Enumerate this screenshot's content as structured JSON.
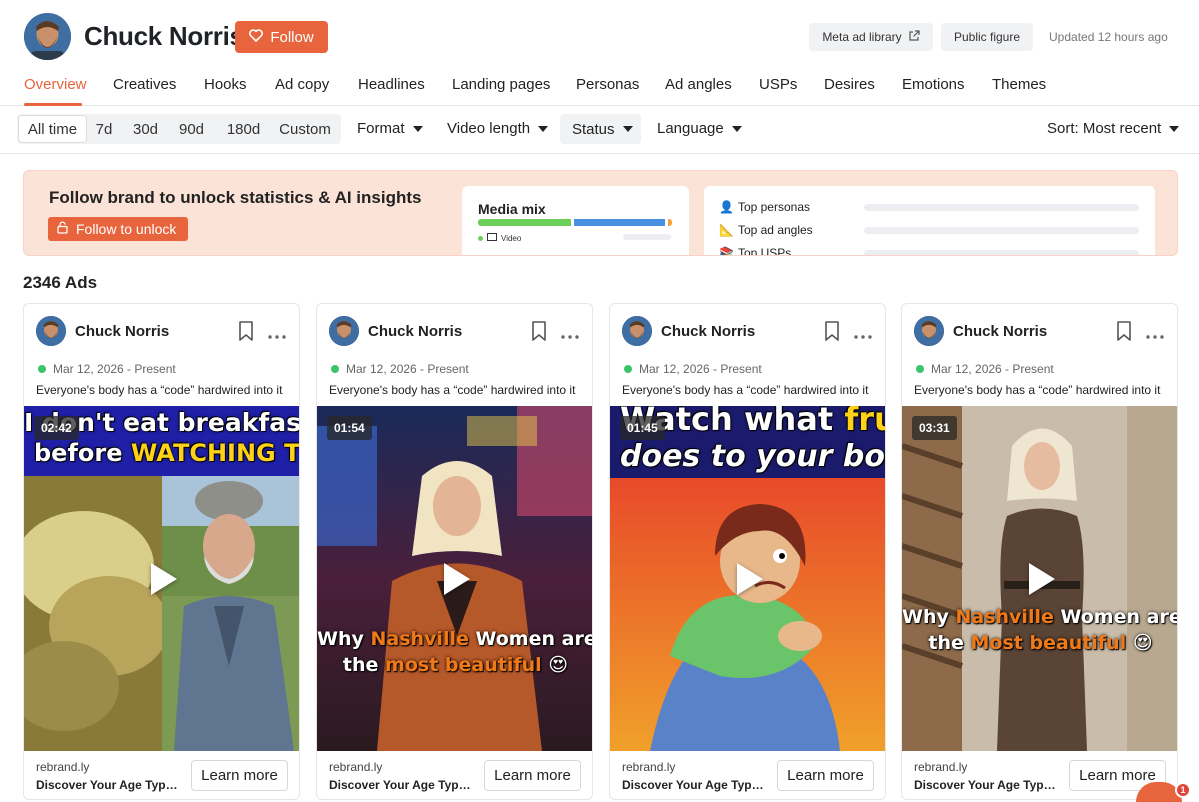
{
  "brand": {
    "name": "Chuck Norris",
    "follow_label": "Follow",
    "meta_ad_library_label": "Meta ad library",
    "public_figure_label": "Public figure",
    "updated_text": "Updated 12 hours ago"
  },
  "tabs": [
    {
      "label": "Overview",
      "active": true
    },
    {
      "label": "Creatives"
    },
    {
      "label": "Hooks"
    },
    {
      "label": "Ad copy"
    },
    {
      "label": "Headlines"
    },
    {
      "label": "Landing pages"
    },
    {
      "label": "Personas"
    },
    {
      "label": "Ad angles"
    },
    {
      "label": "USPs"
    },
    {
      "label": "Desires"
    },
    {
      "label": "Emotions"
    },
    {
      "label": "Themes"
    }
  ],
  "filters": {
    "ranges": [
      "All time",
      "7d",
      "30d",
      "90d",
      "180d",
      "Custom"
    ],
    "active_range": "All time",
    "format_label": "Format",
    "video_length_label": "Video length",
    "status_label": "Status",
    "language_label": "Language",
    "sort_label": "Sort: Most recent"
  },
  "banner": {
    "title": "Follow brand to unlock statistics & AI insights",
    "unlock_label": "Follow to unlock",
    "media_mix_title": "Media mix",
    "media_legend": "Video",
    "stats": [
      {
        "icon": "👤",
        "label": "Top personas"
      },
      {
        "icon": "📐",
        "label": "Top ad angles"
      },
      {
        "icon": "📚",
        "label": "Top USPs"
      }
    ]
  },
  "ads_count": "2346 Ads",
  "cards": [
    {
      "name": "Chuck Norris",
      "date": "Mar 12, 2026 - Present",
      "text": "Everyone's body has a “code” hardwired into it",
      "duration": "02:42",
      "overlay_line1": "I don't eat breakfast",
      "overlay_line2a": "before ",
      "overlay_line2b": "WATCHING THIS",
      "domain": "rebrand.ly",
      "cta_title": "Discover Your Age Type Today",
      "learn_more": "Learn more"
    },
    {
      "name": "Chuck Norris",
      "date": "Mar 12, 2026 - Present",
      "text": "Everyone's body has a “code” hardwired into it",
      "duration": "01:54",
      "caption_a": "Why ",
      "caption_b": "Nashville",
      "caption_c": " Women are",
      "caption_d": "the ",
      "caption_e": "most beautiful",
      "caption_f": " 😍",
      "domain": "rebrand.ly",
      "cta_title": "Discover Your Age Type Today",
      "learn_more": "Learn more"
    },
    {
      "name": "Chuck Norris",
      "date": "Mar 12, 2026 - Present",
      "text": "Everyone's body has a “code” hardwired into it",
      "duration": "01:45",
      "overlay_line1a": "Watch what ",
      "overlay_line1b": "fruit",
      "overlay_line2": "does to your body",
      "domain": "rebrand.ly",
      "cta_title": "Discover Your Age Type Today",
      "learn_more": "Learn more"
    },
    {
      "name": "Chuck Norris",
      "date": "Mar 12, 2026 - Present",
      "text": "Everyone's body has a “code” hardwired into it",
      "duration": "03:31",
      "caption_a": "Why ",
      "caption_b": "Nashville",
      "caption_c": " Women are",
      "caption_d": "the ",
      "caption_e": "Most beautiful",
      "caption_f": " 😍",
      "domain": "rebrand.ly",
      "cta_title": "Discover Your Age Type Today",
      "learn_more": "Learn more"
    }
  ],
  "chat": {
    "badge": "1"
  },
  "colors": {
    "accent": "#e8643c",
    "status_active": "#3bc46a"
  }
}
